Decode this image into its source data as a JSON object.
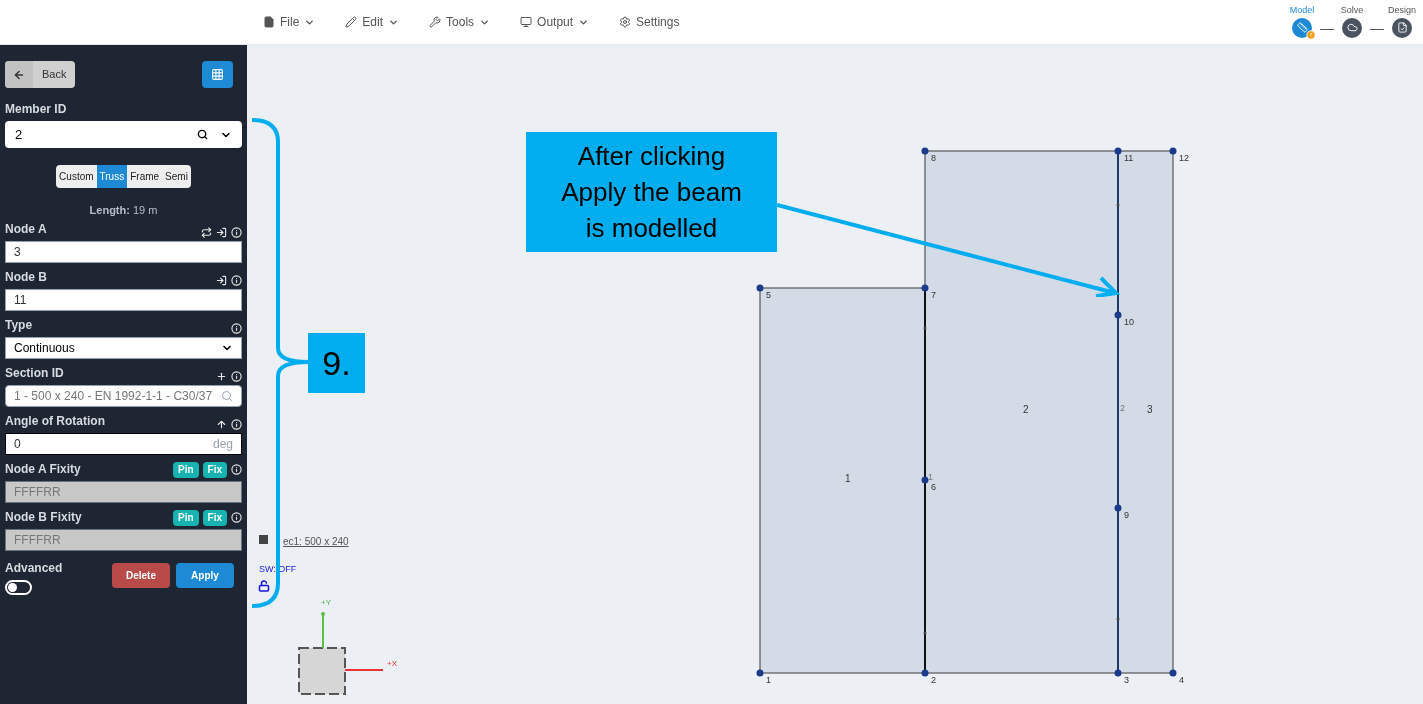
{
  "menu": [
    {
      "label": "File",
      "dropdown": true
    },
    {
      "label": "Edit",
      "dropdown": true
    },
    {
      "label": "Tools",
      "dropdown": true
    },
    {
      "label": "Output",
      "dropdown": true
    },
    {
      "label": "Settings",
      "dropdown": false
    }
  ],
  "steps": [
    {
      "label": "Model",
      "selected": true,
      "warning": true
    },
    {
      "label": "Solve",
      "selected": false,
      "warning": false
    },
    {
      "label": "Design",
      "selected": false,
      "warning": false
    }
  ],
  "sidebar": {
    "back": "Back",
    "member_id": {
      "label": "Member ID",
      "value": "2"
    },
    "member_types": [
      {
        "label": "Custom",
        "selected": false
      },
      {
        "label": "Truss",
        "selected": true
      },
      {
        "label": "Frame",
        "selected": false
      },
      {
        "label": "Semi",
        "selected": false
      }
    ],
    "length": {
      "label": "Length:",
      "value": "19 m"
    },
    "fields": [
      {
        "kind": "text",
        "label": "Node A",
        "value": "3"
      },
      {
        "kind": "text",
        "label": "Node B",
        "value": "11"
      },
      {
        "kind": "select",
        "label": "Type",
        "value": "Continuous"
      },
      {
        "kind": "search",
        "label": "Section ID",
        "placeholder": "1 - 500 x 240 - EN 1992-1-1 - C30/37"
      },
      {
        "kind": "unit",
        "label": "Angle of Rotation",
        "value": "0",
        "unit": "deg"
      },
      {
        "kind": "fixity",
        "label": "Node A Fixity",
        "value": "FFFFRR",
        "disabled": true,
        "buttons": [
          "Pin",
          "Fix"
        ]
      },
      {
        "kind": "fixity",
        "label": "Node B Fixity",
        "value": "FFFFRR",
        "disabled": true,
        "buttons": [
          "Pin",
          "Fix"
        ]
      }
    ],
    "advanced": {
      "label": "Advanced",
      "on": false
    },
    "buttons": [
      {
        "kind": "danger",
        "label": "Delete"
      },
      {
        "kind": "primary",
        "label": "Apply"
      }
    ]
  },
  "canvas": {
    "legend": {
      "section": "ec1: 500 x 240",
      "self_weight": "SW: OFF"
    },
    "axes": {
      "y": "+Y",
      "x": "+X"
    },
    "plates": [
      "1",
      "2",
      "3"
    ],
    "member_labels": [
      "1",
      "2"
    ],
    "nodes": [
      "8",
      "11",
      "12",
      "5",
      "7",
      "10",
      "6",
      "9",
      "1",
      "2",
      "3",
      "4"
    ],
    "callout": "After clicking Apply the beam is modelled",
    "step_badge": "9."
  }
}
